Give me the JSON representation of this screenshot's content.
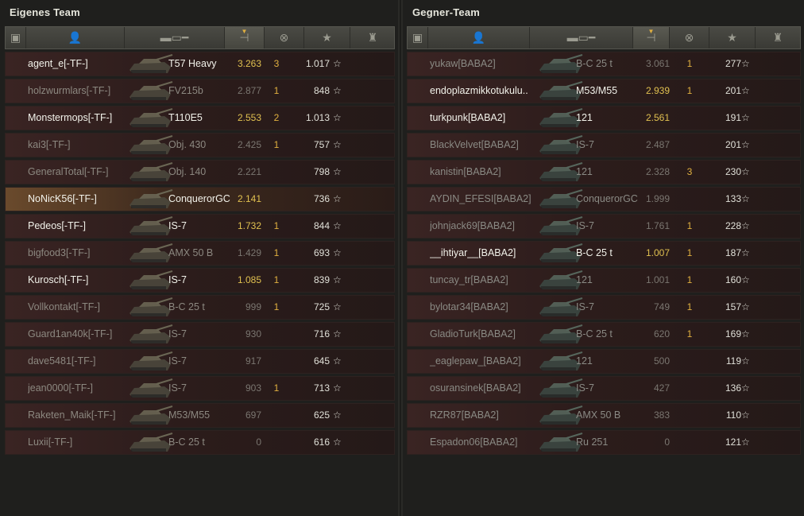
{
  "own_team": {
    "title": "Eigenes Team",
    "header_icons": [
      "vehicle-type-icon",
      "player-icon",
      "tank-icon",
      "damage-icon",
      "kills-icon",
      "xp-star-icon",
      "medal-icon"
    ],
    "sorted_column": "damage",
    "players": [
      {
        "name": "agent_e[-TF-]",
        "tank": "T57 Heavy",
        "rating": "3.263",
        "frags": "3",
        "xp": "1.017",
        "alive": true,
        "highlight": false
      },
      {
        "name": "holzwurmlars[-TF-]",
        "tank": "FV215b",
        "rating": "2.877",
        "frags": "1",
        "xp": "848",
        "alive": false,
        "highlight": false
      },
      {
        "name": "Monstermops[-TF-]",
        "tank": "T110E5",
        "rating": "2.553",
        "frags": "2",
        "xp": "1.013",
        "alive": true,
        "highlight": false
      },
      {
        "name": "kai3[-TF-]",
        "tank": "Obj. 430",
        "rating": "2.425",
        "frags": "1",
        "xp": "757",
        "alive": false,
        "highlight": false
      },
      {
        "name": "GeneralTotal[-TF-]",
        "tank": "Obj. 140",
        "rating": "2.221",
        "frags": "",
        "xp": "798",
        "alive": false,
        "highlight": false
      },
      {
        "name": "NoNicK56[-TF-]",
        "tank": "ConquerorGC",
        "rating": "2.141",
        "frags": "",
        "xp": "736",
        "alive": true,
        "highlight": true
      },
      {
        "name": "Pedeos[-TF-]",
        "tank": "IS-7",
        "rating": "1.732",
        "frags": "1",
        "xp": "844",
        "alive": true,
        "highlight": false
      },
      {
        "name": "bigfood3[-TF-]",
        "tank": "AMX 50 B",
        "rating": "1.429",
        "frags": "1",
        "xp": "693",
        "alive": false,
        "highlight": false
      },
      {
        "name": "Kurosch[-TF-]",
        "tank": "IS-7",
        "rating": "1.085",
        "frags": "1",
        "xp": "839",
        "alive": true,
        "highlight": false
      },
      {
        "name": "Vollkontakt[-TF-]",
        "tank": "B-C 25 t",
        "rating": "999",
        "frags": "1",
        "xp": "725",
        "alive": false,
        "highlight": false
      },
      {
        "name": "Guard1an40k[-TF-]",
        "tank": "IS-7",
        "rating": "930",
        "frags": "",
        "xp": "716",
        "alive": false,
        "highlight": false
      },
      {
        "name": "dave5481[-TF-]",
        "tank": "IS-7",
        "rating": "917",
        "frags": "",
        "xp": "645",
        "alive": false,
        "highlight": false
      },
      {
        "name": "jean0000[-TF-]",
        "tank": "IS-7",
        "rating": "903",
        "frags": "1",
        "xp": "713",
        "alive": false,
        "highlight": false
      },
      {
        "name": "Raketen_Maik[-TF-]",
        "tank": "M53/M55",
        "rating": "697",
        "frags": "",
        "xp": "625",
        "alive": false,
        "highlight": false
      },
      {
        "name": "Luxii[-TF-]",
        "tank": "B-C 25 t",
        "rating": "0",
        "frags": "",
        "xp": "616",
        "alive": false,
        "highlight": false
      }
    ]
  },
  "enemy_team": {
    "title": "Gegner-Team",
    "players": [
      {
        "name": "yukaw[BABA2]",
        "tank": "B-C 25 t",
        "rating": "3.061",
        "frags": "1",
        "xp": "277",
        "alive": false
      },
      {
        "name": "endoplazmikkotukulu..",
        "tank": "M53/M55",
        "rating": "2.939",
        "frags": "1",
        "xp": "201",
        "alive": true
      },
      {
        "name": "turkpunk[BABA2]",
        "tank": "121",
        "rating": "2.561",
        "frags": "",
        "xp": "191",
        "alive": true
      },
      {
        "name": "BlackVelvet[BABA2]",
        "tank": "IS-7",
        "rating": "2.487",
        "frags": "",
        "xp": "201",
        "alive": false
      },
      {
        "name": "kanistin[BABA2]",
        "tank": "121",
        "rating": "2.328",
        "frags": "3",
        "xp": "230",
        "alive": false
      },
      {
        "name": "AYDIN_EFESI[BABA2]",
        "tank": "ConquerorGC",
        "rating": "1.999",
        "frags": "",
        "xp": "133",
        "alive": false
      },
      {
        "name": "johnjack69[BABA2]",
        "tank": "IS-7",
        "rating": "1.761",
        "frags": "1",
        "xp": "228",
        "alive": false
      },
      {
        "name": "__ihtiyar__[BABA2]",
        "tank": "B-C 25 t",
        "rating": "1.007",
        "frags": "1",
        "xp": "187",
        "alive": true
      },
      {
        "name": "tuncay_tr[BABA2]",
        "tank": "121",
        "rating": "1.001",
        "frags": "1",
        "xp": "160",
        "alive": false
      },
      {
        "name": "bylotar34[BABA2]",
        "tank": "IS-7",
        "rating": "749",
        "frags": "1",
        "xp": "157",
        "alive": false
      },
      {
        "name": "GladioTurk[BABA2]",
        "tank": "B-C 25 t",
        "rating": "620",
        "frags": "1",
        "xp": "169",
        "alive": false
      },
      {
        "name": "_eaglepaw_[BABA2]",
        "tank": "121",
        "rating": "500",
        "frags": "",
        "xp": "119",
        "alive": false
      },
      {
        "name": "osuransinek[BABA2]",
        "tank": "IS-7",
        "rating": "427",
        "frags": "",
        "xp": "136",
        "alive": false
      },
      {
        "name": "RZR87[BABA2]",
        "tank": "AMX 50 B",
        "rating": "383",
        "frags": "",
        "xp": "110",
        "alive": false
      },
      {
        "name": "Espadon06[BABA2]",
        "tank": "Ru 251",
        "rating": "0",
        "frags": "",
        "xp": "121",
        "alive": false
      }
    ]
  },
  "star_glyph": "☆"
}
